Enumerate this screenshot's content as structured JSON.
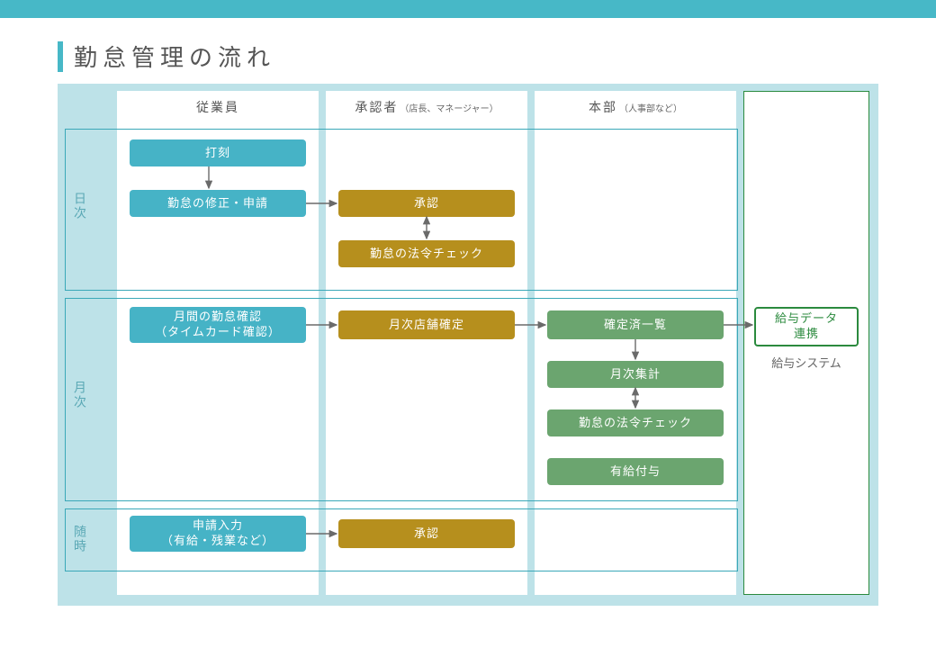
{
  "title": "勤怠管理の流れ",
  "columns": {
    "employee": {
      "label": "従業員",
      "sub": ""
    },
    "approver": {
      "label": "承認者",
      "sub": "（店長、マネージャー）"
    },
    "hq": {
      "label": "本部",
      "sub": "（人事部など）"
    },
    "external_label": "給与システム"
  },
  "rows": {
    "daily": {
      "label": "日次"
    },
    "monthly": {
      "label": "月次"
    },
    "anytime": {
      "label": "随時"
    }
  },
  "nodes": {
    "clockin": "打刻",
    "edit_apply": "勤怠の修正・申請",
    "approve1": "承認",
    "law_check1": "勤怠の法令チェック",
    "month_confirm": "月間の勤怠確認\n（タイムカード確認）",
    "store_fix": "月次店舗確定",
    "fixed_list": "確定済一覧",
    "month_agg": "月次集計",
    "law_check2": "勤怠の法令チェック",
    "paid_grant": "有給付与",
    "apply_input": "申請入力\n（有給・残業など）",
    "approve2": "承認",
    "payroll_link": "給与データ\n連携"
  }
}
